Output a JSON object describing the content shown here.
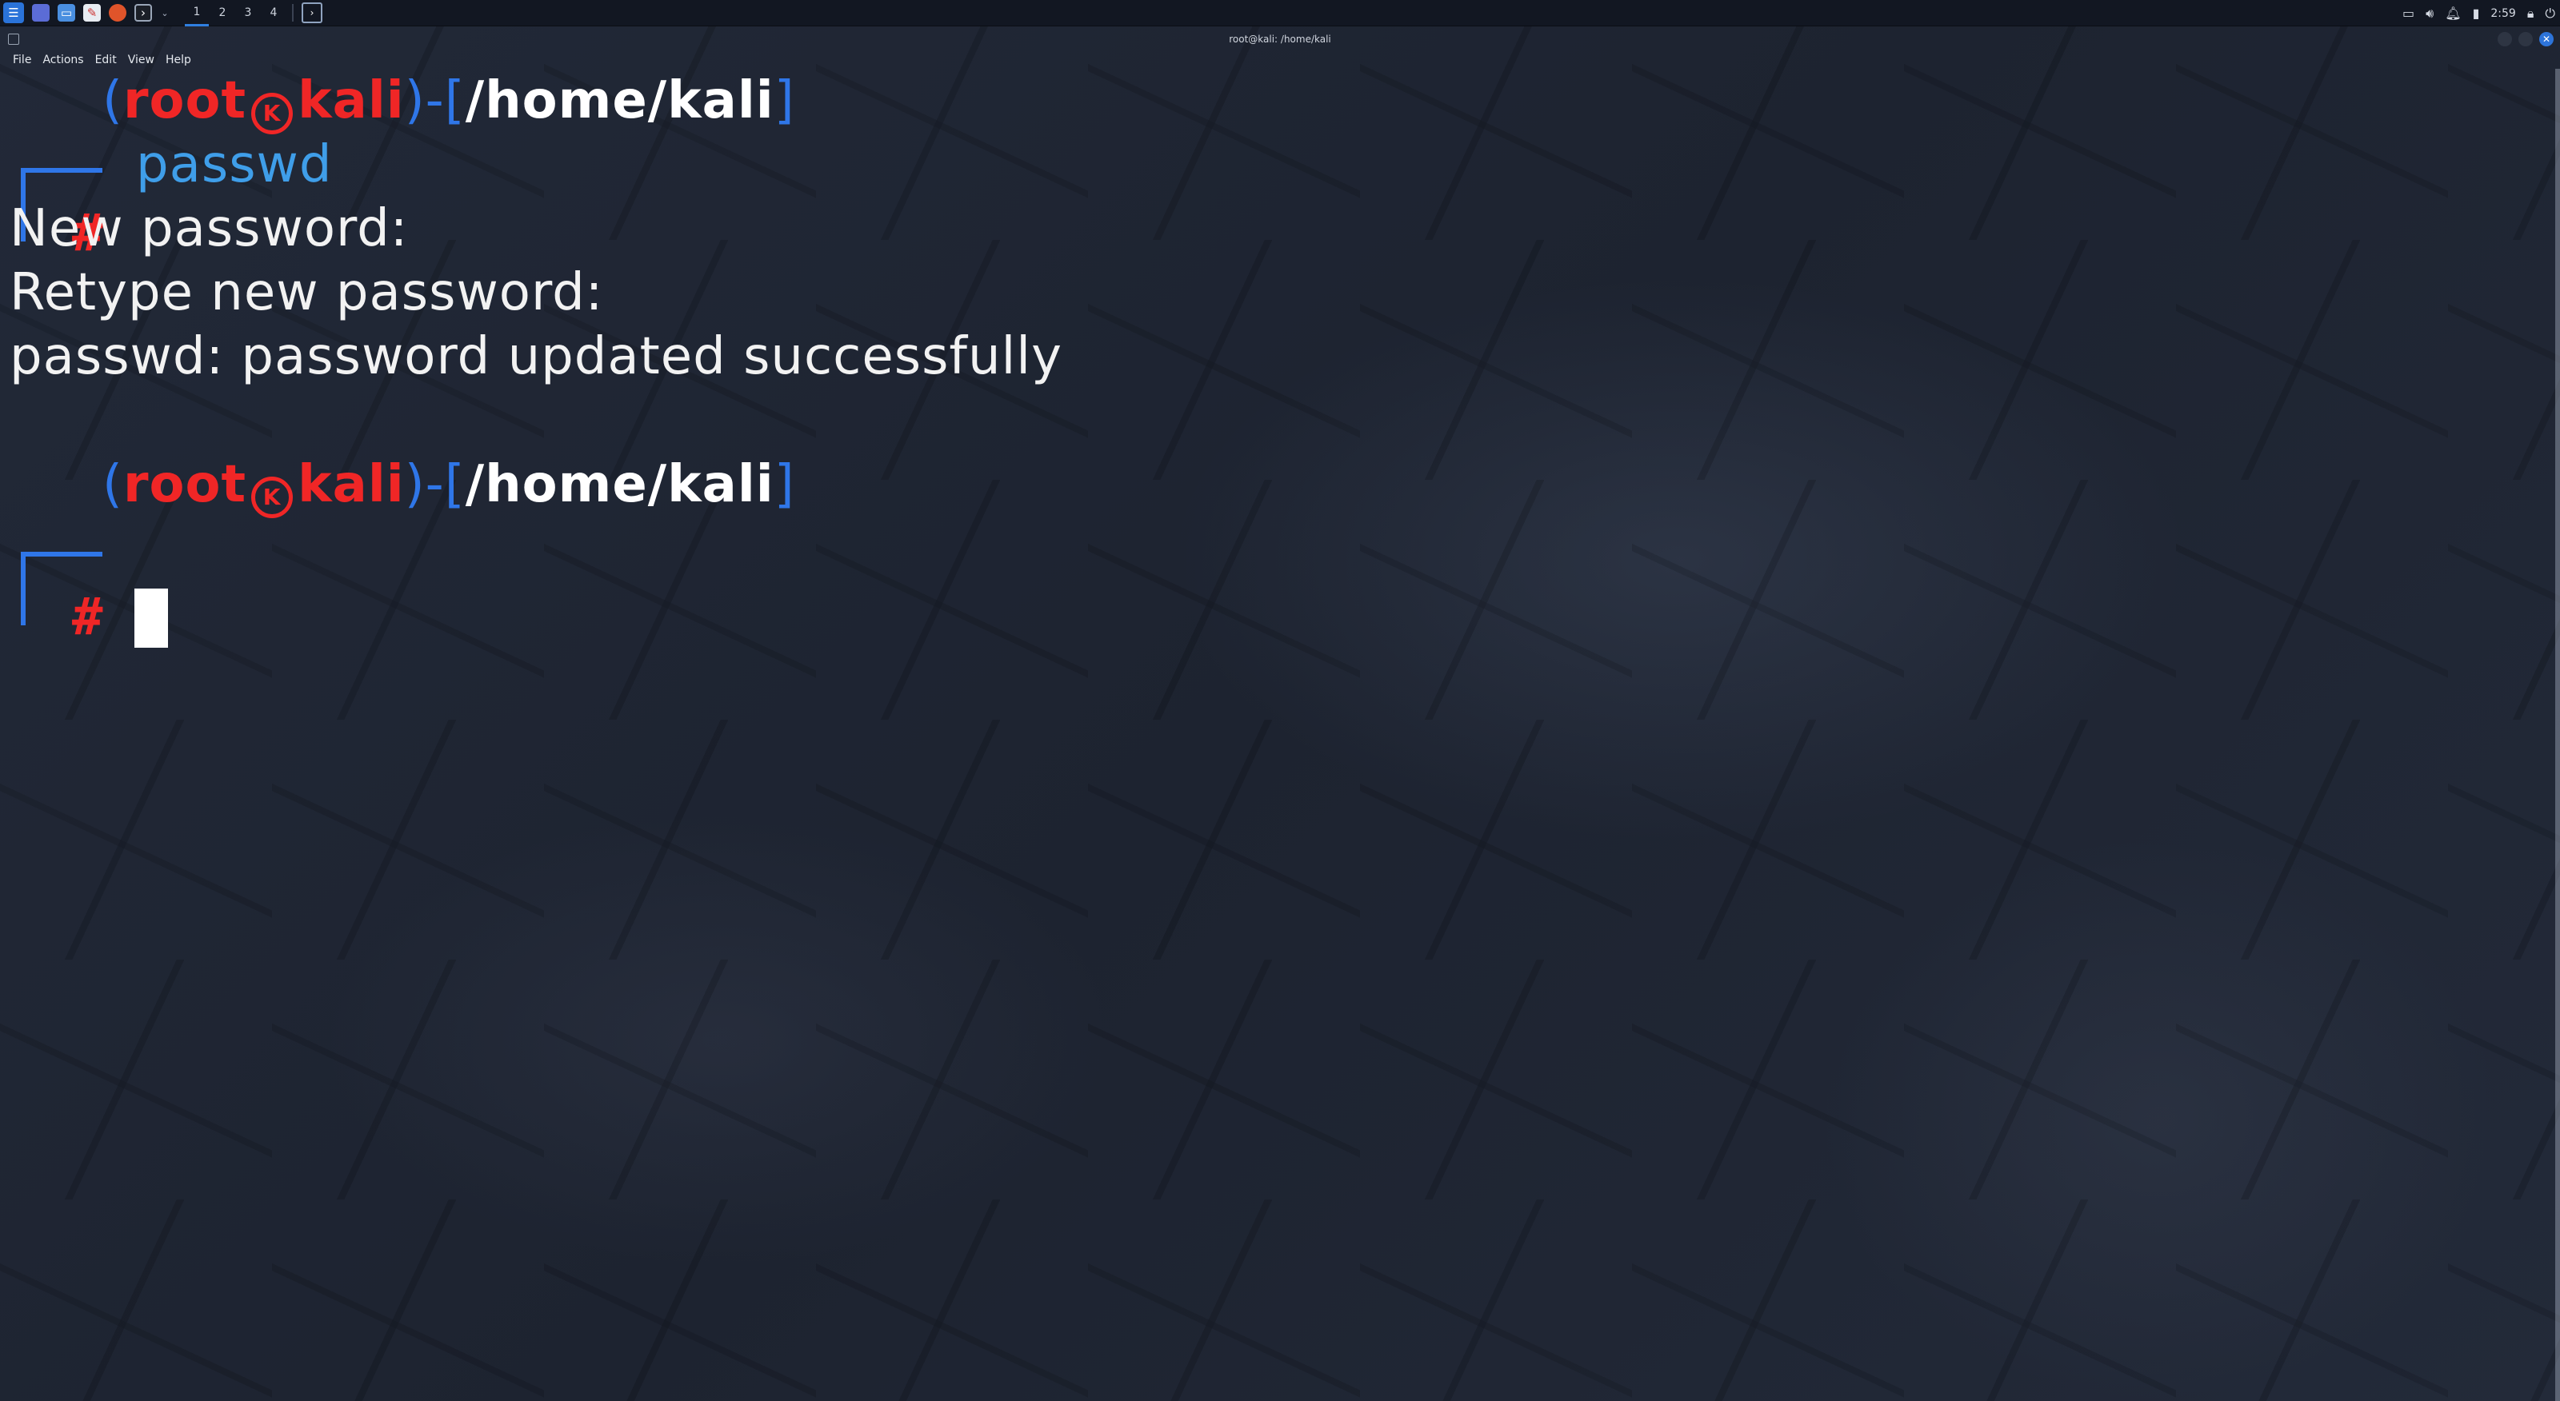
{
  "panel": {
    "workspaces": [
      "1",
      "2",
      "3",
      "4"
    ],
    "active_workspace": "1",
    "clock": "2:59",
    "app_icons": [
      "kali-menu-icon",
      "desktop-icon",
      "file-manager-icon",
      "text-editor-icon",
      "firefox-icon",
      "terminal-icon"
    ]
  },
  "window": {
    "title": "root@kali: /home/kali",
    "menu": [
      "File",
      "Actions",
      "Edit",
      "View",
      "Help"
    ]
  },
  "terminal": {
    "prompt": {
      "user": "root",
      "host": "kali",
      "path": "/home/kali",
      "hash": "#"
    },
    "command": "passwd",
    "output": [
      "New password:",
      "Retype new password:",
      "passwd: password updated successfully"
    ]
  },
  "colors": {
    "prompt_blue": "#2f76e8",
    "prompt_red": "#f02626",
    "command_cyan": "#3f9ee9",
    "background": "#1e2430"
  }
}
